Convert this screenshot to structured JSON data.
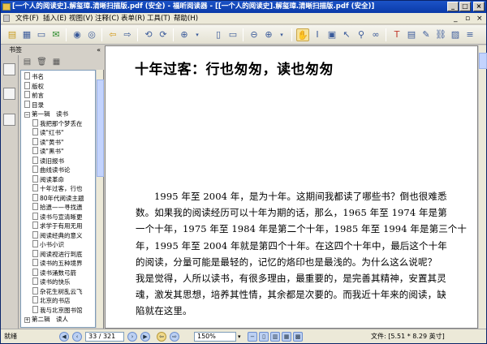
{
  "window": {
    "title": "[一个人的阅读史].解玺璋.清晰扫描版.pdf (安全) - 福昕阅读器 - [[一个人的阅读史].解玺璋.清晰扫描版.pdf (安全)]"
  },
  "menu": [
    "文件(F)",
    "插入(E)",
    "视图(V)",
    "注释(C)",
    "表单(R)",
    "工具(T)",
    "帮助(H)"
  ],
  "sidebar": {
    "title": "书签",
    "close": "«",
    "items": [
      {
        "label": "书名",
        "indent": 0,
        "type": "page"
      },
      {
        "label": "版权",
        "indent": 0,
        "type": "page"
      },
      {
        "label": "前言",
        "indent": 0,
        "type": "page"
      },
      {
        "label": "目录",
        "indent": 0,
        "type": "page"
      },
      {
        "label": "第一辑　读书",
        "indent": 0,
        "type": "expanded"
      },
      {
        "label": "我把那个梦丢在",
        "indent": 1,
        "type": "page"
      },
      {
        "label": "读\"红书\"",
        "indent": 1,
        "type": "page"
      },
      {
        "label": "读\"黄书\"",
        "indent": 1,
        "type": "page"
      },
      {
        "label": "读\"黑书\"",
        "indent": 1,
        "type": "page"
      },
      {
        "label": "读旧报书",
        "indent": 1,
        "type": "page"
      },
      {
        "label": "曲线读书论",
        "indent": 1,
        "type": "page"
      },
      {
        "label": "阅读革命",
        "indent": 1,
        "type": "page"
      },
      {
        "label": "十年过客，行也",
        "indent": 1,
        "type": "page"
      },
      {
        "label": "80年代阅读主题",
        "indent": 1,
        "type": "page"
      },
      {
        "label": "拾遗——寻找遗",
        "indent": 1,
        "type": "page"
      },
      {
        "label": "读书与宣清晰更",
        "indent": 1,
        "type": "page"
      },
      {
        "label": "求学于有用无用",
        "indent": 1,
        "type": "page"
      },
      {
        "label": "阅读经典的意义",
        "indent": 1,
        "type": "page"
      },
      {
        "label": "小书小识",
        "indent": 1,
        "type": "page"
      },
      {
        "label": "阅读视进行到底",
        "indent": 1,
        "type": "page"
      },
      {
        "label": "读书的五种境界",
        "indent": 1,
        "type": "page"
      },
      {
        "label": "读书涌数弓箭",
        "indent": 1,
        "type": "page"
      },
      {
        "label": "读书的快乐",
        "indent": 1,
        "type": "page"
      },
      {
        "label": "杂花生树乱云飞",
        "indent": 1,
        "type": "page"
      },
      {
        "label": "北京的书店",
        "indent": 1,
        "type": "page"
      },
      {
        "label": "我与北京图书馆",
        "indent": 1,
        "type": "page"
      },
      {
        "label": "第二辑　读人",
        "indent": 0,
        "type": "collapsed"
      }
    ]
  },
  "document": {
    "heading": "十年过客：行也匆匆，读也匆匆",
    "paragraph_lines": [
      "1995 年至 2004 年，是为十年。这期间我都读了哪些书？倒也很难悉",
      "数。如果我的阅读经历可以十年为期的话，那么，1965 年至 1974 年是第",
      "一个十年，1975 年至 1984 年是第二个十年，1985 年至 1994 年是第三个十",
      "年，1995 年至 2004 年就是第四个十年。在这四个十年中，最后这个十年",
      "的阅读，分量可能是最轻的，记忆的烙印也是最浅的。为什么这么说呢？",
      "我是觉得，人所以读书，有很多理由，最重要的，是完善其精神，安置其灵",
      "魂，激发其思想，培养其性情，其余都是次要的。而我近十年来的阅读，缺",
      "陷就在这里。"
    ]
  },
  "status": {
    "ready": "就绪",
    "page": "33 / 321",
    "zoom": "150%",
    "file_size": "文件: [5.51 * 8.29 英寸]"
  }
}
